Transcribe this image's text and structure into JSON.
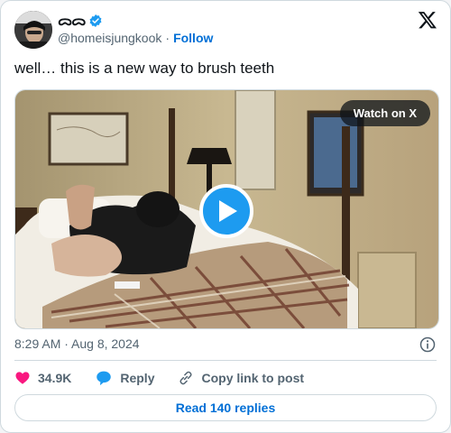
{
  "user": {
    "display_name": "ᯅᯅ",
    "handle": "@homeisjungkook",
    "follow_label": "Follow",
    "verified_color": "#1d9bf0"
  },
  "tweet": {
    "text": "well… this is a new way to brush teeth",
    "timestamp": "8:29 AM · Aug 8, 2024"
  },
  "media": {
    "watch_label": "Watch on X",
    "play_icon": "play-icon"
  },
  "actions": {
    "likes": "34.9K",
    "reply_label": "Reply",
    "copy_label": "Copy link to post"
  },
  "footer": {
    "read_replies_label": "Read 140 replies"
  },
  "colors": {
    "accent": "#1d9bf0",
    "link": "#006fd6",
    "heart": "#f91880",
    "text": "#0f1419",
    "muted": "#536471"
  }
}
